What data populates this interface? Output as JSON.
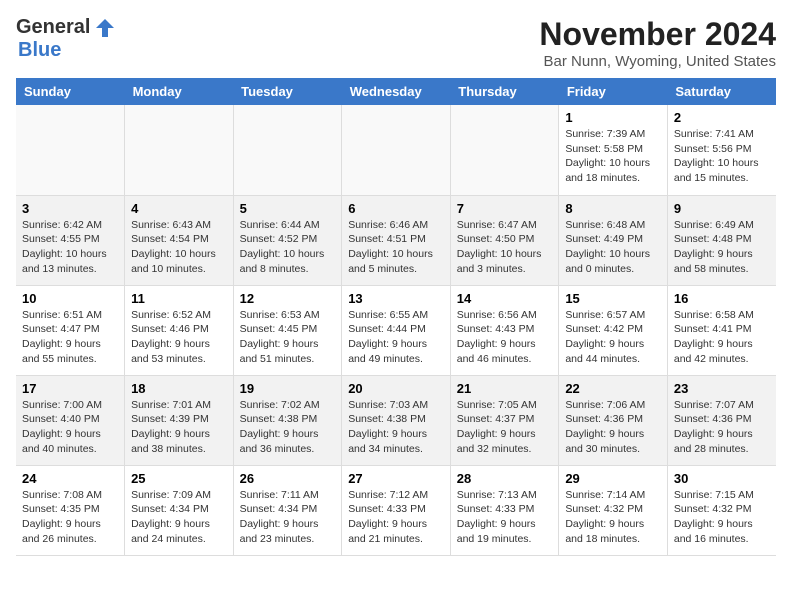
{
  "header": {
    "logo_general": "General",
    "logo_blue": "Blue",
    "month_title": "November 2024",
    "subtitle": "Bar Nunn, Wyoming, United States"
  },
  "weekdays": [
    "Sunday",
    "Monday",
    "Tuesday",
    "Wednesday",
    "Thursday",
    "Friday",
    "Saturday"
  ],
  "weeks": [
    [
      {
        "day": "",
        "info": ""
      },
      {
        "day": "",
        "info": ""
      },
      {
        "day": "",
        "info": ""
      },
      {
        "day": "",
        "info": ""
      },
      {
        "day": "",
        "info": ""
      },
      {
        "day": "1",
        "info": "Sunrise: 7:39 AM\nSunset: 5:58 PM\nDaylight: 10 hours and 18 minutes."
      },
      {
        "day": "2",
        "info": "Sunrise: 7:41 AM\nSunset: 5:56 PM\nDaylight: 10 hours and 15 minutes."
      }
    ],
    [
      {
        "day": "3",
        "info": "Sunrise: 6:42 AM\nSunset: 4:55 PM\nDaylight: 10 hours and 13 minutes."
      },
      {
        "day": "4",
        "info": "Sunrise: 6:43 AM\nSunset: 4:54 PM\nDaylight: 10 hours and 10 minutes."
      },
      {
        "day": "5",
        "info": "Sunrise: 6:44 AM\nSunset: 4:52 PM\nDaylight: 10 hours and 8 minutes."
      },
      {
        "day": "6",
        "info": "Sunrise: 6:46 AM\nSunset: 4:51 PM\nDaylight: 10 hours and 5 minutes."
      },
      {
        "day": "7",
        "info": "Sunrise: 6:47 AM\nSunset: 4:50 PM\nDaylight: 10 hours and 3 minutes."
      },
      {
        "day": "8",
        "info": "Sunrise: 6:48 AM\nSunset: 4:49 PM\nDaylight: 10 hours and 0 minutes."
      },
      {
        "day": "9",
        "info": "Sunrise: 6:49 AM\nSunset: 4:48 PM\nDaylight: 9 hours and 58 minutes."
      }
    ],
    [
      {
        "day": "10",
        "info": "Sunrise: 6:51 AM\nSunset: 4:47 PM\nDaylight: 9 hours and 55 minutes."
      },
      {
        "day": "11",
        "info": "Sunrise: 6:52 AM\nSunset: 4:46 PM\nDaylight: 9 hours and 53 minutes."
      },
      {
        "day": "12",
        "info": "Sunrise: 6:53 AM\nSunset: 4:45 PM\nDaylight: 9 hours and 51 minutes."
      },
      {
        "day": "13",
        "info": "Sunrise: 6:55 AM\nSunset: 4:44 PM\nDaylight: 9 hours and 49 minutes."
      },
      {
        "day": "14",
        "info": "Sunrise: 6:56 AM\nSunset: 4:43 PM\nDaylight: 9 hours and 46 minutes."
      },
      {
        "day": "15",
        "info": "Sunrise: 6:57 AM\nSunset: 4:42 PM\nDaylight: 9 hours and 44 minutes."
      },
      {
        "day": "16",
        "info": "Sunrise: 6:58 AM\nSunset: 4:41 PM\nDaylight: 9 hours and 42 minutes."
      }
    ],
    [
      {
        "day": "17",
        "info": "Sunrise: 7:00 AM\nSunset: 4:40 PM\nDaylight: 9 hours and 40 minutes."
      },
      {
        "day": "18",
        "info": "Sunrise: 7:01 AM\nSunset: 4:39 PM\nDaylight: 9 hours and 38 minutes."
      },
      {
        "day": "19",
        "info": "Sunrise: 7:02 AM\nSunset: 4:38 PM\nDaylight: 9 hours and 36 minutes."
      },
      {
        "day": "20",
        "info": "Sunrise: 7:03 AM\nSunset: 4:38 PM\nDaylight: 9 hours and 34 minutes."
      },
      {
        "day": "21",
        "info": "Sunrise: 7:05 AM\nSunset: 4:37 PM\nDaylight: 9 hours and 32 minutes."
      },
      {
        "day": "22",
        "info": "Sunrise: 7:06 AM\nSunset: 4:36 PM\nDaylight: 9 hours and 30 minutes."
      },
      {
        "day": "23",
        "info": "Sunrise: 7:07 AM\nSunset: 4:36 PM\nDaylight: 9 hours and 28 minutes."
      }
    ],
    [
      {
        "day": "24",
        "info": "Sunrise: 7:08 AM\nSunset: 4:35 PM\nDaylight: 9 hours and 26 minutes."
      },
      {
        "day": "25",
        "info": "Sunrise: 7:09 AM\nSunset: 4:34 PM\nDaylight: 9 hours and 24 minutes."
      },
      {
        "day": "26",
        "info": "Sunrise: 7:11 AM\nSunset: 4:34 PM\nDaylight: 9 hours and 23 minutes."
      },
      {
        "day": "27",
        "info": "Sunrise: 7:12 AM\nSunset: 4:33 PM\nDaylight: 9 hours and 21 minutes."
      },
      {
        "day": "28",
        "info": "Sunrise: 7:13 AM\nSunset: 4:33 PM\nDaylight: 9 hours and 19 minutes."
      },
      {
        "day": "29",
        "info": "Sunrise: 7:14 AM\nSunset: 4:32 PM\nDaylight: 9 hours and 18 minutes."
      },
      {
        "day": "30",
        "info": "Sunrise: 7:15 AM\nSunset: 4:32 PM\nDaylight: 9 hours and 16 minutes."
      }
    ]
  ]
}
